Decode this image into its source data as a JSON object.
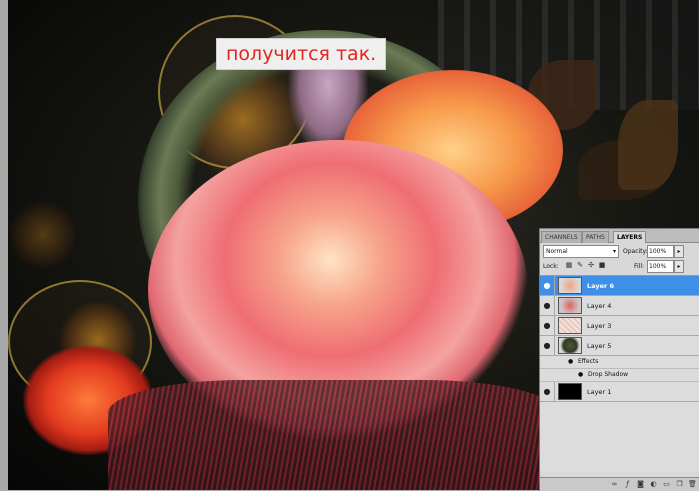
{
  "canvas": {
    "caption": "получится так."
  },
  "layers_panel": {
    "tabs": [
      {
        "label": "CHANNELS",
        "active": false
      },
      {
        "label": "PATHS",
        "active": false
      },
      {
        "label": "LAYERS",
        "active": true
      }
    ],
    "blend_mode": "Normal",
    "opacity_label": "Opacity:",
    "opacity_value": "100%",
    "lock_label": "Lock:",
    "fill_label": "Fill:",
    "fill_value": "100%",
    "layers": [
      {
        "name": "Layer 6",
        "selected": true
      },
      {
        "name": "Layer 4",
        "selected": false
      },
      {
        "name": "Layer 3",
        "selected": false
      },
      {
        "name": "Layer 5",
        "selected": false
      },
      {
        "name": "Layer 1",
        "selected": false
      }
    ],
    "effects_label": "Effects",
    "drop_shadow_label": "Drop Shadow",
    "icons": {
      "eye": "eye-icon",
      "lock": [
        "lock-transparent-icon",
        "lock-brush-icon",
        "lock-move-icon",
        "lock-all-icon"
      ],
      "footer": [
        "link-icon",
        "fx-icon",
        "mask-icon",
        "adjustment-icon",
        "group-icon",
        "new-layer-icon",
        "trash-icon"
      ]
    },
    "colors": {
      "selected_row": "#3f8fe6",
      "caption_text": "#e1261c"
    }
  }
}
